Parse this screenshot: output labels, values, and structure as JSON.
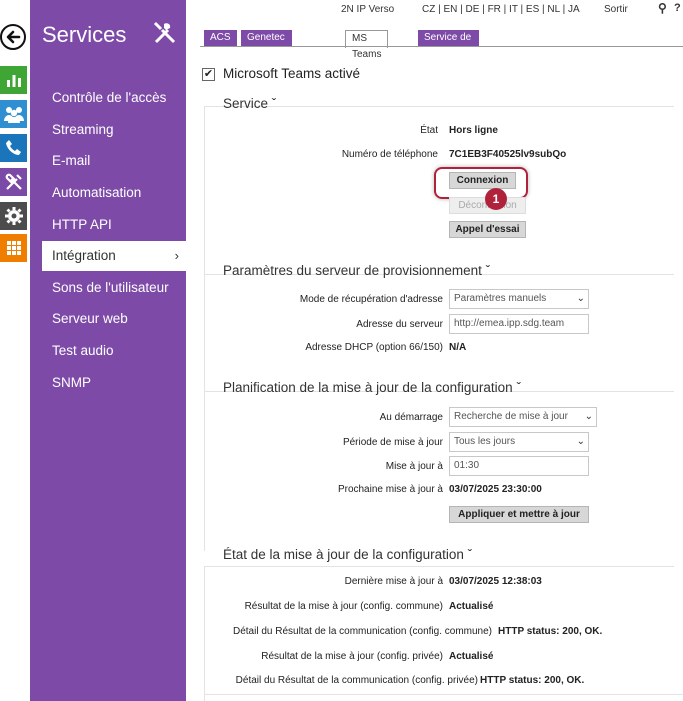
{
  "topbar": {
    "product": "2N IP Verso",
    "languages": "CZ | EN | DE | FR | IT | ES | NL | JA",
    "logout": "Sortir",
    "search_glyph": "⚲",
    "help": "?"
  },
  "iconstrip": {
    "back_glyph": "➜",
    "items": [
      "chart-icon",
      "users-icon",
      "phone-icon",
      "tools-icon",
      "gear-icon",
      "grid-icon"
    ]
  },
  "sidebar": {
    "title": "Services",
    "items": [
      {
        "label": "Contrôle de l'accès"
      },
      {
        "label": "Streaming"
      },
      {
        "label": "E-mail"
      },
      {
        "label": "Automatisation"
      },
      {
        "label": "HTTP API"
      },
      {
        "label": "Intégration",
        "active": true,
        "chevron": "›"
      },
      {
        "label": "Sons de l'utilisateur"
      },
      {
        "label": "Serveur web"
      },
      {
        "label": "Test audio"
      },
      {
        "label": "SNMP"
      }
    ]
  },
  "tabs": [
    {
      "label": "ACS"
    },
    {
      "label": "Genetec Synergis"
    },
    {
      "label": "MS Teams",
      "active": true
    },
    {
      "label": "Service de découverte"
    }
  ],
  "teams_enabled": {
    "checked": true,
    "check_glyph": "✔",
    "label": "Microsoft Teams activé"
  },
  "service": {
    "title": "Service",
    "toggle": "ˇ",
    "state_label": "État",
    "state_value": "Hors ligne",
    "phone_label": "Numéro de téléphone",
    "phone_value": "7C1EB3F40525lv9subQo",
    "connect_button": "Connexion",
    "disconnect_button": "Déconnexion",
    "test_call_button": "Appel d'essai",
    "callout_number": "1"
  },
  "provisioning": {
    "title": "Paramètres du serveur de provisionnement",
    "toggle": "ˇ",
    "mode_label": "Mode de récupération d'adresse",
    "mode_value": "Paramètres manuels",
    "server_label": "Adresse du serveur",
    "server_value": "http://emea.ipp.sdg.team",
    "dhcp_label": "Adresse DHCP (option 66/150)",
    "dhcp_value": "N/A"
  },
  "schedule": {
    "title": "Planification de la mise à jour de la configuration",
    "toggle": "ˇ",
    "startup_label": "Au démarrage",
    "startup_value": "Recherche de mise à jour",
    "period_label": "Période de mise à jour",
    "period_value": "Tous les jours",
    "time_label": "Mise à jour à",
    "time_value": "01:30",
    "next_label": "Prochaine mise à jour à",
    "next_value": "03/07/2025 23:30:00",
    "apply_button": "Appliquer et mettre à jour",
    "dropdown_arrow": "⌄"
  },
  "status": {
    "title": "État de la mise à jour de la configuration",
    "toggle": "ˇ",
    "last_label": "Dernière mise à jour à",
    "last_value": "03/07/2025 12:38:03",
    "common_result_label": "Résultat de la mise à jour (config. commune)",
    "common_result_value": "Actualisé",
    "common_detail_label": "Détail du Résultat de la communication (config. commune)",
    "common_detail_value": "HTTP status: 200, OK.",
    "private_result_label": "Résultat de la mise à jour (config. privée)",
    "private_result_value": "Actualisé",
    "private_detail_label": "Détail du Résultat de la communication (config. privée)",
    "private_detail_value": "HTTP status: 200, OK."
  },
  "colors": {
    "accent_purple": "#7d4ba7",
    "highlight": "#b0223c"
  }
}
